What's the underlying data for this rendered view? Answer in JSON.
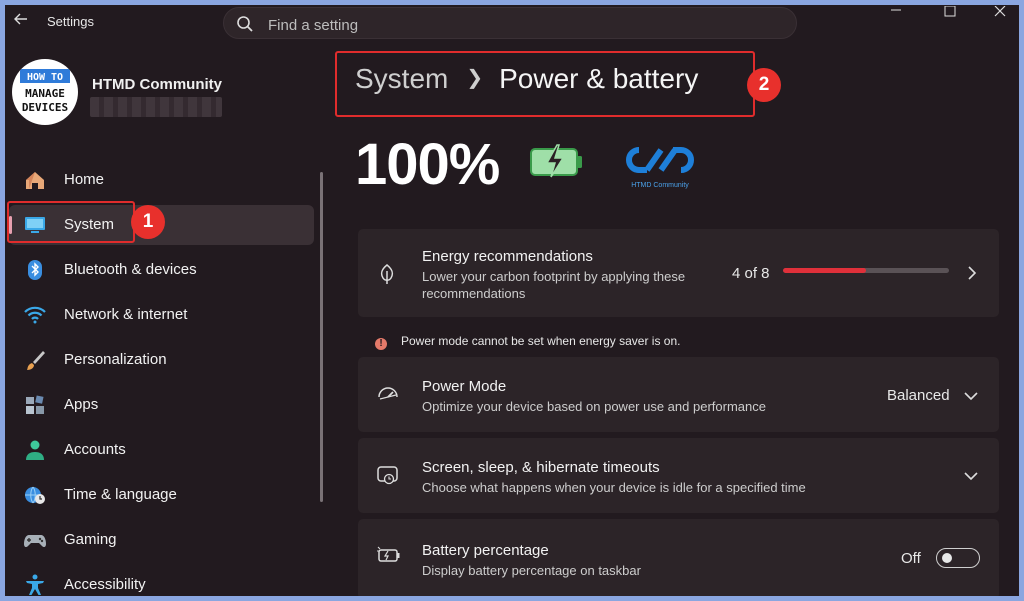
{
  "window": {
    "title": "Settings"
  },
  "search": {
    "placeholder": "Find a setting"
  },
  "user": {
    "name": "HTMD Community",
    "avatar_text_top": "HOW TO",
    "avatar_text_mid": "MANAGE",
    "avatar_text_bot": "DEVICES"
  },
  "sidebar": {
    "items": [
      {
        "label": "Home",
        "icon": "home-icon"
      },
      {
        "label": "System",
        "icon": "monitor-icon",
        "selected": true
      },
      {
        "label": "Bluetooth & devices",
        "icon": "bluetooth-icon"
      },
      {
        "label": "Network & internet",
        "icon": "wifi-icon"
      },
      {
        "label": "Personalization",
        "icon": "brush-icon"
      },
      {
        "label": "Apps",
        "icon": "apps-icon"
      },
      {
        "label": "Accounts",
        "icon": "person-icon"
      },
      {
        "label": "Time & language",
        "icon": "globe-clock-icon"
      },
      {
        "label": "Gaming",
        "icon": "gamepad-icon"
      },
      {
        "label": "Accessibility",
        "icon": "accessibility-icon"
      }
    ]
  },
  "annotations": {
    "badge1": "1",
    "badge2": "2"
  },
  "breadcrumb": {
    "parent": "System",
    "current": "Power & battery"
  },
  "battery": {
    "percent": "100%",
    "logo_text": "HTMD Community"
  },
  "cards": {
    "energy": {
      "title": "Energy recommendations",
      "desc_line1": "Lower your carbon footprint by applying these",
      "desc_line2": "recommendations",
      "count": "4 of 8",
      "progress": 0.5
    },
    "warning": "Power mode cannot be set when energy saver is on.",
    "power_mode": {
      "title": "Power Mode",
      "desc": "Optimize your device based on power use and performance",
      "value": "Balanced"
    },
    "screen": {
      "title": "Screen, sleep, & hibernate timeouts",
      "desc": "Choose what happens when your device is idle for a specified time"
    },
    "battery_pct": {
      "title": "Battery percentage",
      "desc": "Display battery percentage on taskbar",
      "state": "Off"
    }
  },
  "colors": {
    "accent": "#e0303a",
    "annotation": "#e8302c",
    "background": "#221a1f",
    "card": "#2c2428"
  }
}
